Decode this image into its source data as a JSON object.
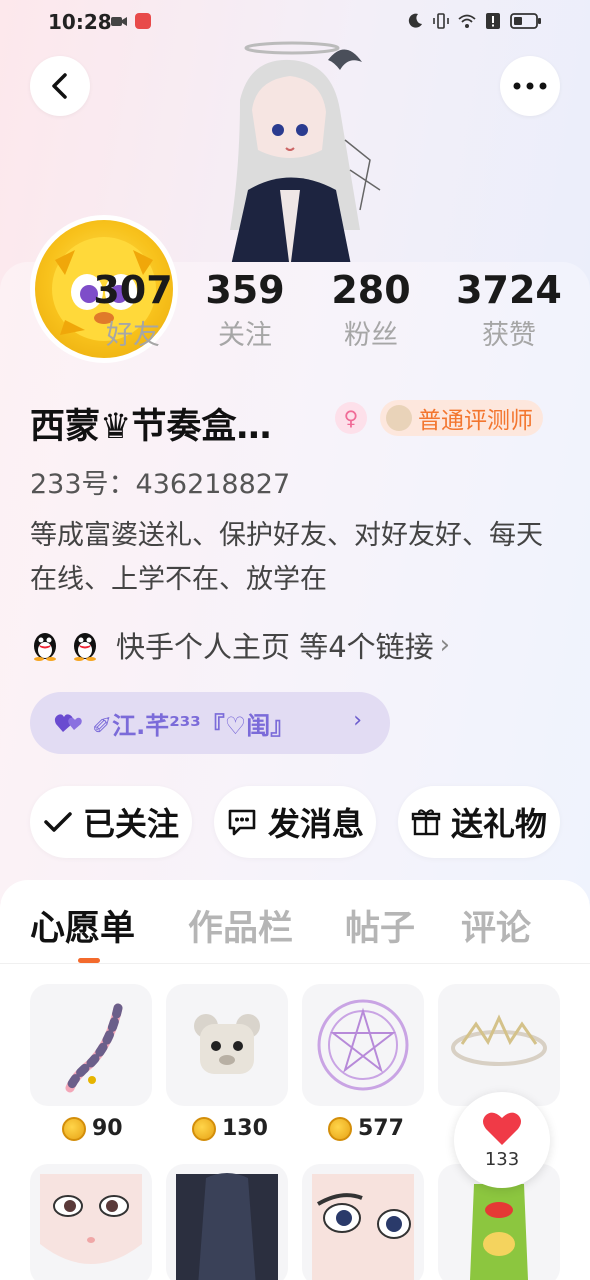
{
  "status_bar": {
    "time": "10:28",
    "icons": [
      "video-icon",
      "app-badge-icon",
      "moon-icon",
      "vibrate-icon",
      "wifi-icon",
      "alert-icon",
      "battery-icon"
    ]
  },
  "profile": {
    "name": "西蒙♛节奏盒…",
    "title_badge": "普通评测师",
    "uid": "233号：436218827",
    "bio": "等成富婆送礼、保护好友、对好友好、每天在线、上学不在、放学在",
    "links_text": "快手个人主页 等4个链接",
    "group_name": "✐江.芊²³³『♡闺』"
  },
  "stats": [
    {
      "value": "307",
      "label": "好友"
    },
    {
      "value": "359",
      "label": "关注"
    },
    {
      "value": "280",
      "label": "粉丝"
    },
    {
      "value": "3724",
      "label": "获赞"
    }
  ],
  "actions": {
    "follow": "已关注",
    "message": "发消息",
    "gift": "送礼物"
  },
  "tabs": [
    "心愿单",
    "作品栏",
    "帖子",
    "评论"
  ],
  "wishlist": [
    {
      "icon": "tail-icon",
      "price": "90"
    },
    {
      "icon": "bear-mask-icon",
      "price": "130"
    },
    {
      "icon": "magic-circle-icon",
      "price": "577"
    },
    {
      "icon": "headpiece-icon",
      "price": ""
    }
  ],
  "wishlist_row2": [
    "face-icon",
    "hair-icon",
    "eye-icon",
    "chips-icon"
  ],
  "like_count": "133",
  "colors": {
    "accent_orange": "#f36a2c",
    "group_purple": "#7b6bd9",
    "badge_orange": "#f3762f"
  }
}
